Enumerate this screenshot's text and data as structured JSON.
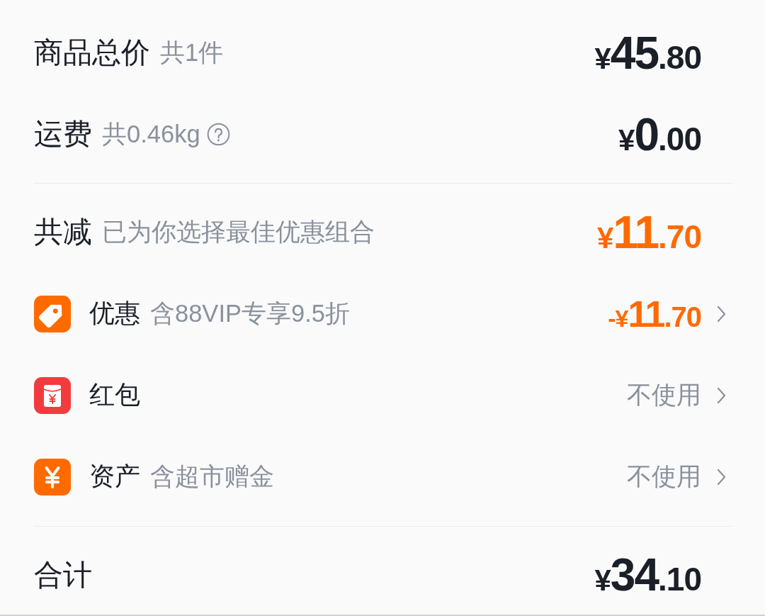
{
  "charges": [
    {
      "label": "商品总价",
      "note": "共1件",
      "info_icon": false,
      "amount": "¥45.80"
    },
    {
      "label": "运费",
      "note": "共0.46kg",
      "info_icon": true,
      "amount": "¥0.00"
    }
  ],
  "savings": {
    "label": "共减",
    "note": "已为你选择最佳优惠组合",
    "amount": "¥11.70"
  },
  "options": [
    {
      "kind": "tag",
      "label": "优惠",
      "note": "含88VIP专享9.5折",
      "value": {
        "kind": "price",
        "text": "-¥11.70"
      }
    },
    {
      "kind": "envelope",
      "label": "红包",
      "value": {
        "kind": "text",
        "text": "不使用"
      }
    },
    {
      "kind": "yen",
      "label": "资产",
      "note": "含超市赠金",
      "value": {
        "kind": "text",
        "text": "不使用"
      }
    }
  ],
  "total": {
    "label": "合计",
    "amount": "¥34.10"
  }
}
